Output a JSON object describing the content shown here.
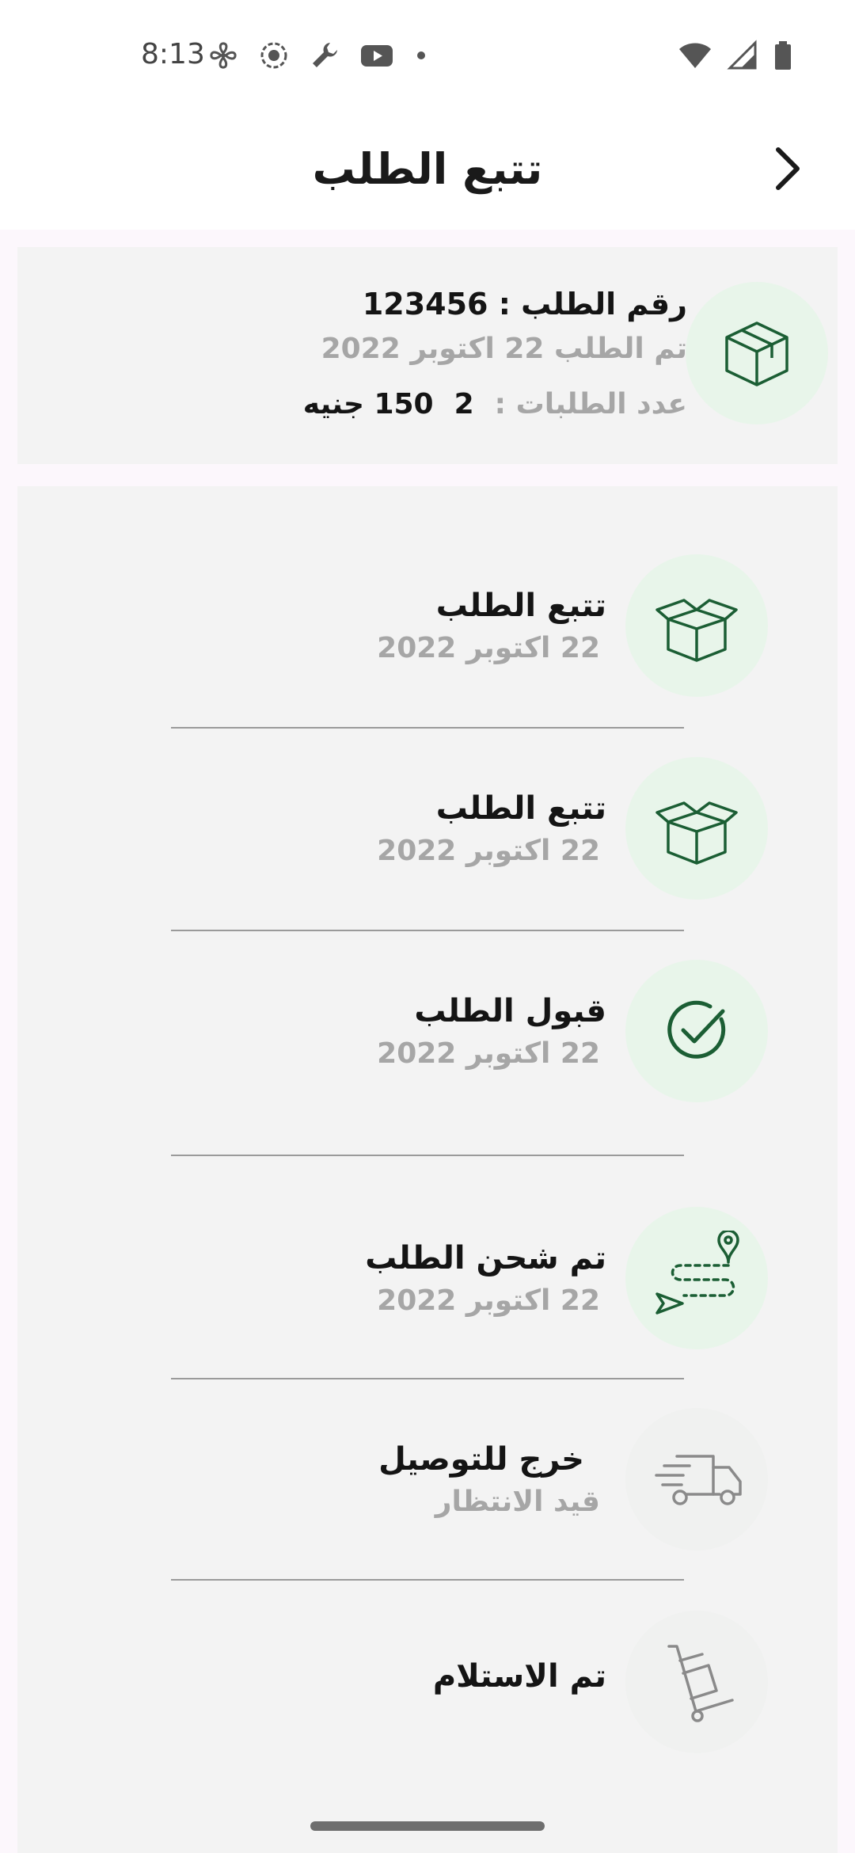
{
  "status_bar": {
    "time": "8:13",
    "left_icons": [
      "fan-icon",
      "record-icon",
      "wrench-icon",
      "youtube-icon",
      "dot-icon"
    ],
    "right_icons": [
      "wifi-icon",
      "signal-icon",
      "battery-icon"
    ]
  },
  "header": {
    "title": "تتبع الطلب",
    "back_icon": "chevron-right-icon"
  },
  "order": {
    "number": "رقم الطلب : 123456",
    "date": "تم الطلب 22 اكتوبر 2022",
    "count_label": "عدد الطلبات :",
    "count_value": "2",
    "total": "150 جنيه",
    "icon": "package-icon"
  },
  "timeline": {
    "steps": [
      {
        "title": "تتبع الطلب",
        "date": "22 اكتوبر 2022",
        "icon": "open-box-icon",
        "completed": true
      },
      {
        "title": "تتبع الطلب",
        "date": "22 اكتوبر 2022",
        "icon": "open-box-icon",
        "completed": true
      },
      {
        "title": "قبول  الطلب",
        "date": "22 اكتوبر 2022",
        "icon": "check-circle-icon",
        "completed": true
      },
      {
        "title": "تم شحن  الطلب",
        "date": "22 اكتوبر 2022",
        "icon": "route-icon",
        "completed": true
      },
      {
        "title": "خرج للتوصيل",
        "date": "قيد الانتظار",
        "icon": "delivery-truck-icon",
        "completed": false
      },
      {
        "title": "تم الاستلام",
        "date": "",
        "icon": "hand-truck-icon",
        "completed": false
      }
    ]
  },
  "colors": {
    "accent": "#1b5e34",
    "circle_active": "#e8f5ea",
    "muted_text": "#a6a6a6",
    "inactive_icon": "#8a8a8a"
  }
}
